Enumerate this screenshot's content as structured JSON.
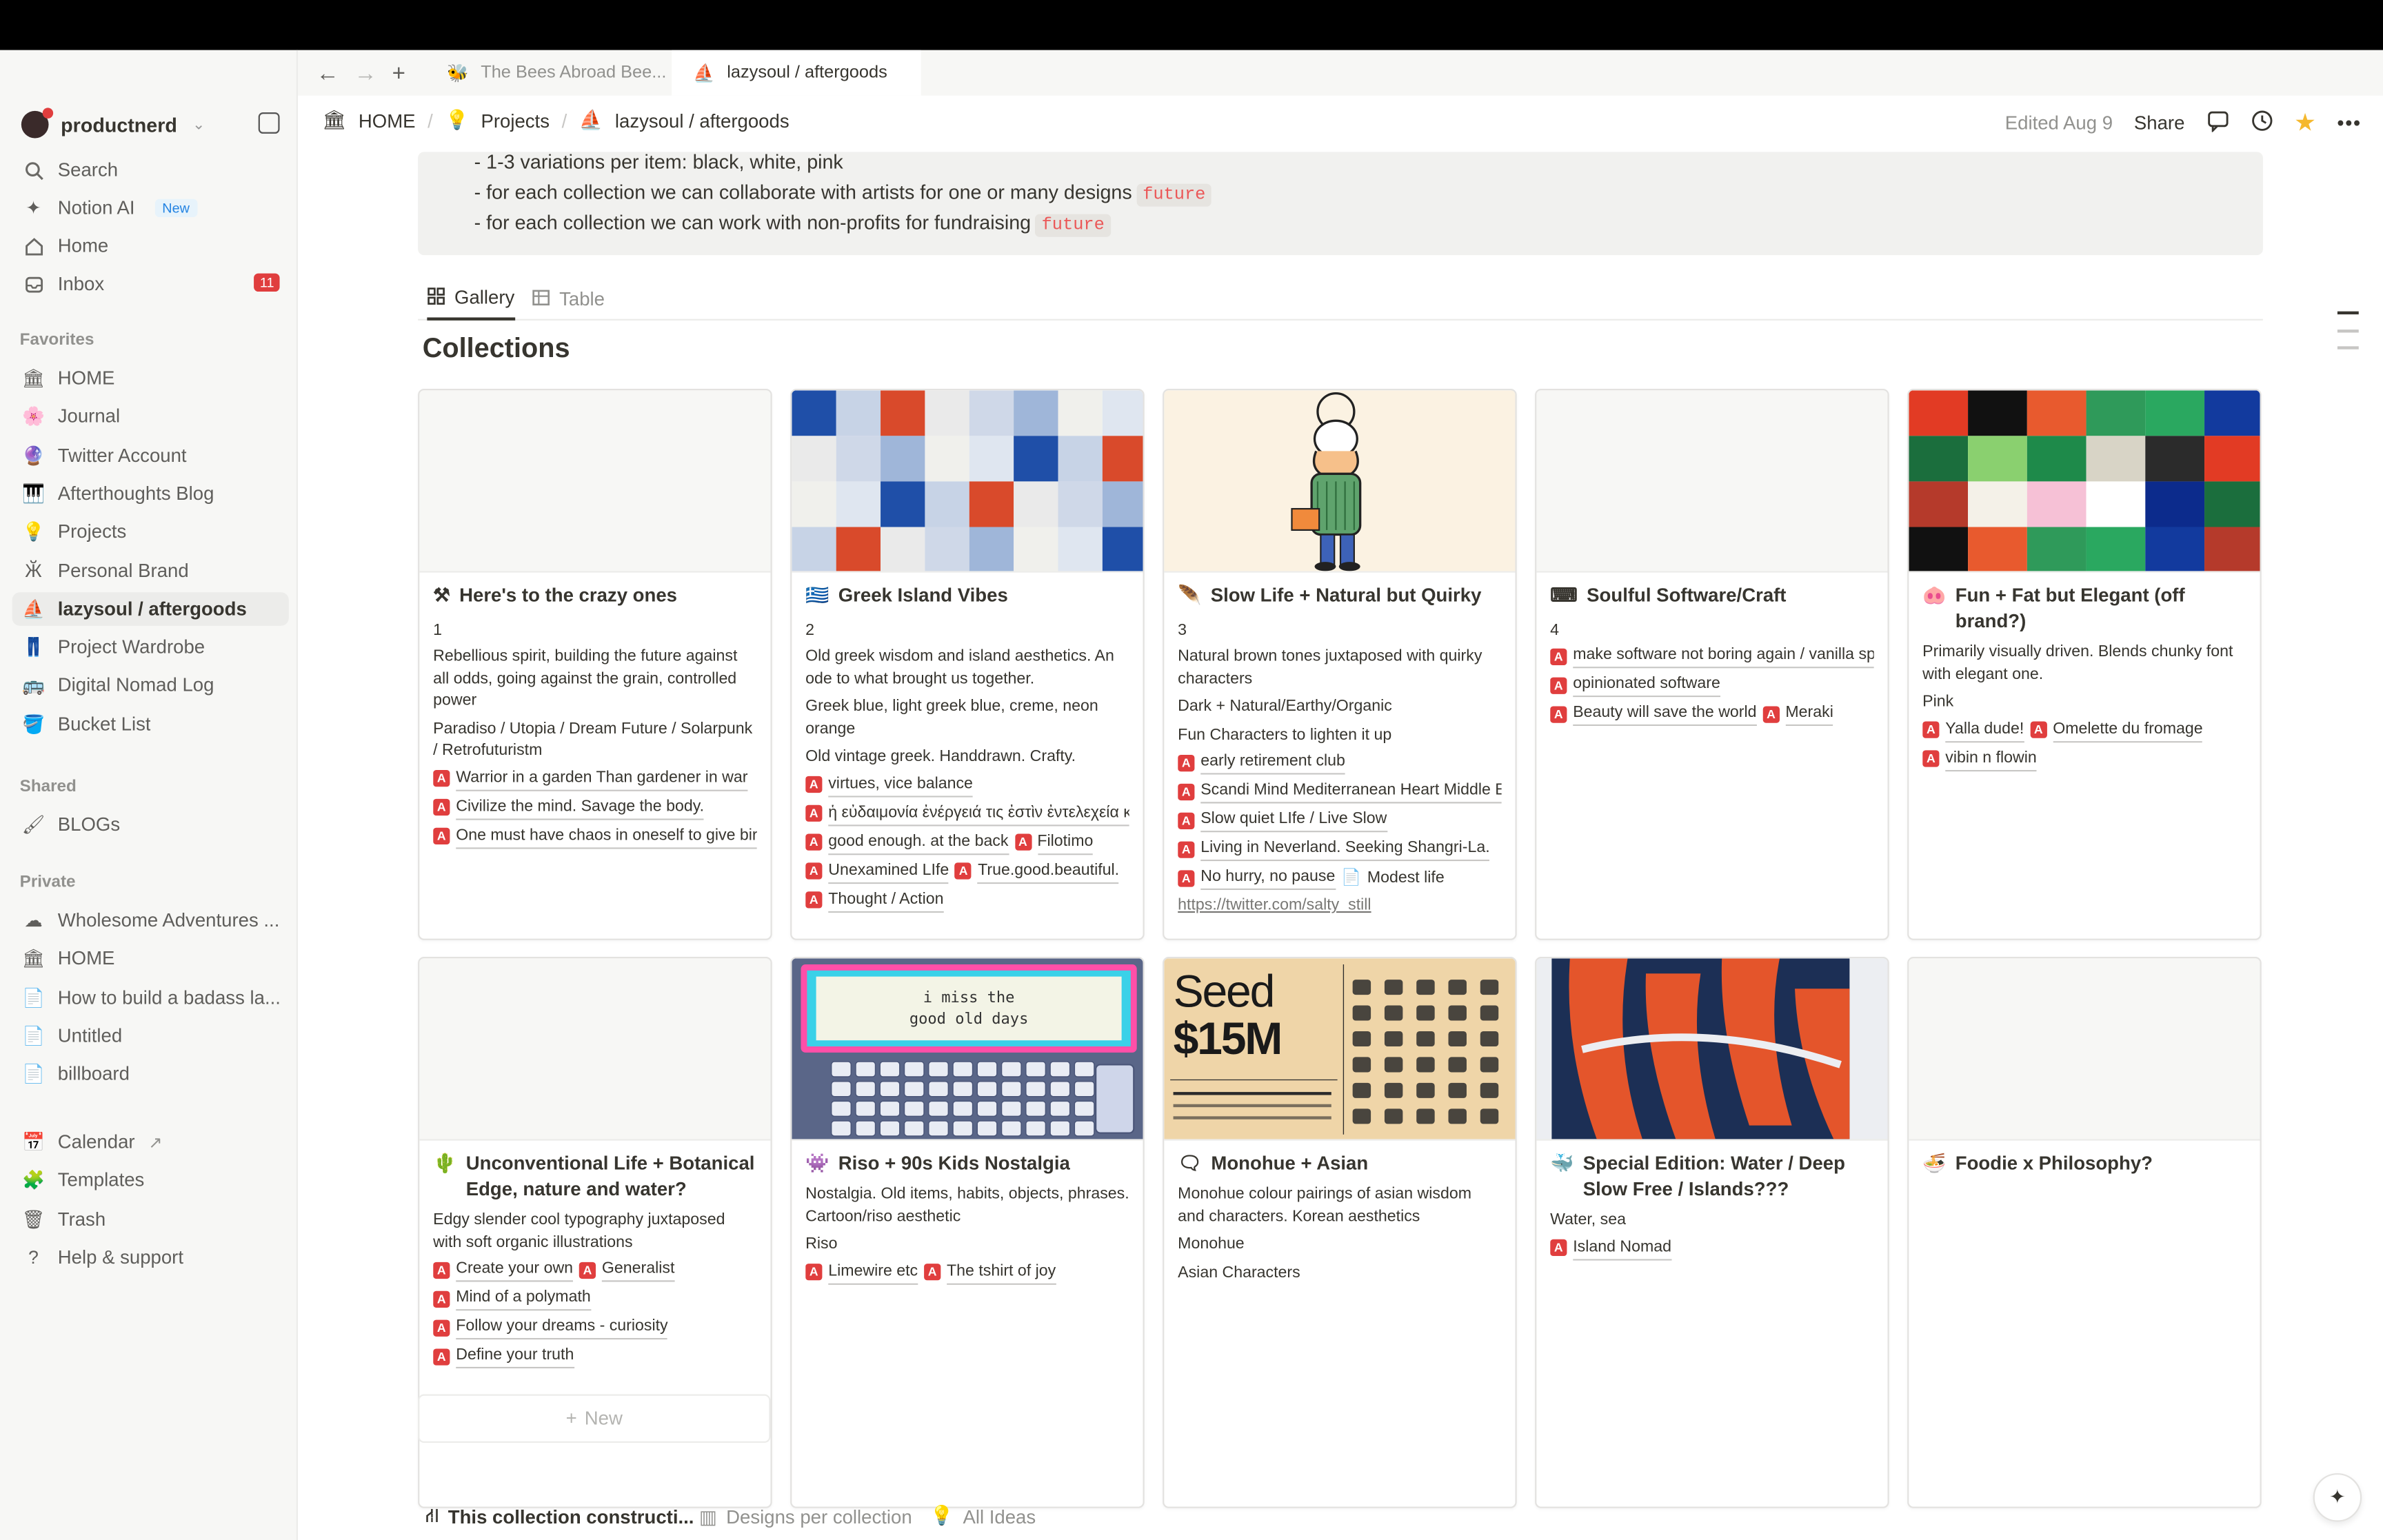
{
  "workspace": {
    "name": "productnerd"
  },
  "sidebar": {
    "top": [
      {
        "label": "Search",
        "icon": "search-icon"
      },
      {
        "label": "Notion AI",
        "icon": "notion-ai-icon",
        "badge": "New"
      },
      {
        "label": "Home",
        "icon": "home-icon"
      },
      {
        "label": "Inbox",
        "icon": "inbox-icon",
        "count": "11"
      }
    ],
    "favorites_label": "Favorites",
    "favorites": [
      {
        "label": "HOME",
        "glyph": "🏛"
      },
      {
        "label": "Journal",
        "glyph": "🌸"
      },
      {
        "label": "Twitter Account",
        "glyph": "🔮"
      },
      {
        "label": "Afterthoughts Blog",
        "glyph": "🎹"
      },
      {
        "label": "Projects",
        "glyph": "💡"
      },
      {
        "label": "Personal Brand",
        "glyph": "Ӂ"
      },
      {
        "label": "lazysoul / aftergoods",
        "glyph": "⛵"
      },
      {
        "label": "Project Wardrobe",
        "glyph": "👖"
      },
      {
        "label": "Digital Nomad Log",
        "glyph": "🚌"
      },
      {
        "label": "Bucket List",
        "glyph": "🪣"
      }
    ],
    "shared_label": "Shared",
    "shared": [
      {
        "label": "BLOGs",
        "glyph": "🖌"
      }
    ],
    "private_label": "Private",
    "private": [
      {
        "label": "Wholesome Adventures ...",
        "glyph": "☁"
      },
      {
        "label": "HOME",
        "glyph": "🏛"
      },
      {
        "label": "How to build a badass la...",
        "glyph": "📄"
      },
      {
        "label": "Untitled",
        "glyph": "📄"
      },
      {
        "label": "billboard",
        "glyph": "📄"
      }
    ],
    "bottom": [
      {
        "label": "Calendar",
        "glyph": "📅",
        "suffix": "↗"
      },
      {
        "label": "Templates",
        "glyph": "🧩"
      },
      {
        "label": "Trash",
        "glyph": "🗑"
      },
      {
        "label": "Help & support",
        "glyph": "?"
      }
    ]
  },
  "browser_tabs": [
    {
      "label": "The Bees Abroad Bee...",
      "active": false
    },
    {
      "label": "lazysoul / aftergoods",
      "active": true
    }
  ],
  "breadcrumb": [
    {
      "label": "HOME",
      "glyph": "🏛"
    },
    {
      "label": "Projects",
      "glyph": "💡"
    },
    {
      "label": "lazysoul / aftergoods",
      "glyph": "⛵"
    }
  ],
  "header": {
    "edited": "Edited Aug 9",
    "share": "Share"
  },
  "callout_lines": [
    {
      "text": "- 1-3 variations per item: black, white, pink",
      "tag": ""
    },
    {
      "text": "- for each collection we can collaborate with artists for one or many designs",
      "tag": "future"
    },
    {
      "text": "- for each collection we can work with non-profits for fundraising",
      "tag": "future"
    }
  ],
  "views": [
    {
      "label": "Gallery",
      "active": true
    },
    {
      "label": "Table",
      "active": false
    }
  ],
  "collection_title": "Collections",
  "cards": [
    {
      "emoji": "⚒",
      "title": "Here's to the crazy ones",
      "cover": "none",
      "num": "1",
      "props": [
        "Rebellious spirit, building the future against all odds, going against the grain, controlled power",
        "Paradiso / Utopia / Dream Future / Solarpunk / Retrofuturistm"
      ],
      "relations": [
        [
          "Warrior in a garden Than gardener in war"
        ],
        [
          "Civilize the mind. Savage the body."
        ],
        [
          "One must have chaos in oneself to give birth"
        ]
      ]
    },
    {
      "emoji": "🇬🇷",
      "title": "Greek Island Vibes",
      "cover": "collage-blue",
      "num": "2",
      "props": [
        "Old greek wisdom and island aesthetics. An ode to what brought us together.",
        "Greek blue, light greek blue, creme, neon orange",
        "Old vintage greek. Handdrawn. Crafty."
      ],
      "relations": [
        [
          "virtues, vice balance"
        ],
        [
          "ἡ εὐδαιμονία ἐνέργειά τις ἐστὶν ἐντελεχεία κ"
        ],
        [
          "good enough. at the back",
          "Filotimo"
        ],
        [
          "Unexamined LIfe",
          "True.good.beautiful."
        ],
        [
          "Thought / Action"
        ]
      ]
    },
    {
      "emoji": "🪶",
      "title": "Slow Life + Natural but Quirky",
      "cover": "character",
      "num": "3",
      "props": [
        "Natural brown tones juxtaposed with quirky characters",
        "Dark + Natural/Earthy/Organic",
        "Fun Characters to lighten it up"
      ],
      "relations": [
        [
          "early retirement club"
        ],
        [
          "Scandi Mind Mediterranean Heart Middle Ea"
        ],
        [
          "Slow quiet LIfe / Live Slow"
        ],
        [
          "Living in Neverland. Seeking Shangri-La."
        ],
        [
          "No hurry, no pause",
          "Modest life"
        ]
      ],
      "link": "https://twitter.com/salty_still"
    },
    {
      "emoji": "⌨",
      "title": "Soulful Software/Craft",
      "cover": "none",
      "num": "4",
      "props": [],
      "relations": [
        [
          "make software not boring again / vanilla spri"
        ],
        [
          "opinionated software"
        ],
        [
          "Beauty will save the world",
          "Meraki"
        ]
      ]
    },
    {
      "emoji": "🐽",
      "title": "Fun + Fat but Elegant (off brand?)",
      "cover": "collage-green",
      "num": "",
      "props": [
        "Primarily visually driven.  Blends chunky font with elegant one.",
        "Pink"
      ],
      "relations": [
        [
          "Yalla dude!",
          "Omelette du fromage"
        ],
        [
          "vibin n flowin"
        ]
      ]
    },
    {
      "emoji": "🌵",
      "title": "Unconventional Life + Botanical Edge, nature and water?",
      "cover": "none",
      "num": "",
      "props": [
        "Edgy slender cool typography juxtaposed with soft organic illustrations"
      ],
      "relations": [
        [
          "Create your own",
          "Generalist"
        ],
        [
          "Mind of a polymath"
        ],
        [
          "Follow your dreams - curiosity"
        ],
        [
          "Define your truth"
        ]
      ]
    },
    {
      "emoji": "👾",
      "title": "Riso + 90s Kids Nostalgia",
      "cover": "pager",
      "cover_text": [
        "i  miss  the",
        "good  old  days"
      ],
      "num": "",
      "props": [
        "Nostalgia. Old items, habits, objects, phrases. Cartoon/riso aesthetic",
        "Riso"
      ],
      "relations": [
        [
          "Limewire etc",
          "The tshirt of joy"
        ]
      ]
    },
    {
      "emoji": "🗨",
      "title": "Monohue + Asian",
      "cover": "poster",
      "cover_text": [
        "Seed",
        "$15M"
      ],
      "num": "",
      "props": [
        "Monohue colour pairings of asian wisdom and characters. Korean aesthetics",
        "Monohue",
        "Asian Characters"
      ],
      "relations": []
    },
    {
      "emoji": "🐳",
      "title": "Special Edition: Water / Deep Slow Free / Islands???",
      "cover": "orange",
      "num": "",
      "props": [
        "Water, sea"
      ],
      "relations": [
        [
          "Island Nomad"
        ]
      ]
    },
    {
      "emoji": "🍜",
      "title": "Foodie x Philosophy?",
      "cover": "none",
      "num": "",
      "props": [],
      "relations": []
    }
  ],
  "new_label": "New",
  "bottom_tabs": [
    {
      "label": "This collection constructi...",
      "active": true
    },
    {
      "label": "Designs per collection",
      "active": false
    },
    {
      "label": "All Ideas",
      "active": false
    }
  ],
  "colors": {
    "accent": "#2383e2",
    "red": "#e03e3e",
    "code": "#eb5757"
  }
}
